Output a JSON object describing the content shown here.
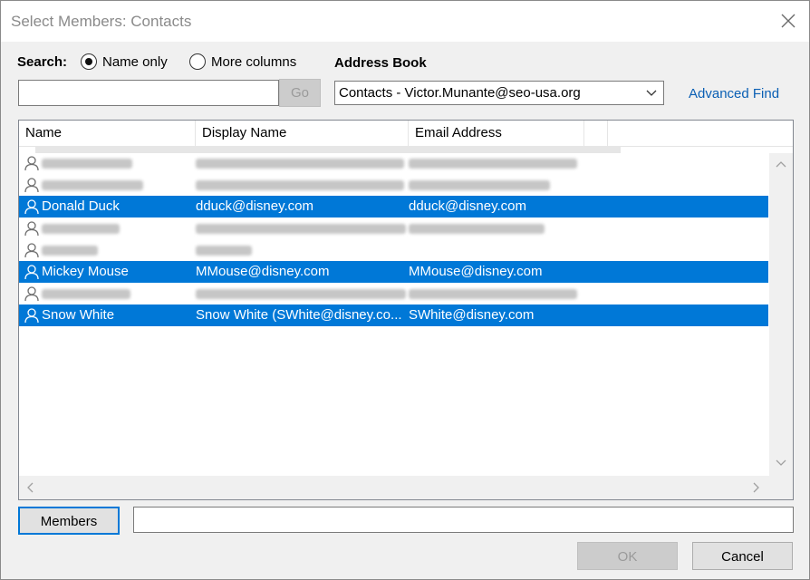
{
  "window": {
    "title": "Select Members: Contacts"
  },
  "search": {
    "label": "Search:",
    "option_name_only": "Name only",
    "option_more_columns": "More columns",
    "selected": "Name only",
    "value": "",
    "go_label": "Go"
  },
  "address_book": {
    "label": "Address Book",
    "selected": "Contacts - Victor.Munante@seo-usa.org",
    "advanced_find": "Advanced Find"
  },
  "table": {
    "columns": [
      "Name",
      "Display Name",
      "Email Address"
    ],
    "rows": [
      {
        "name": "",
        "display": "",
        "email": "",
        "selected": false,
        "blurred": true
      },
      {
        "name": "",
        "display": "",
        "email": "",
        "selected": false,
        "blurred": true
      },
      {
        "name": "Donald Duck",
        "display": "dduck@disney.com",
        "email": "dduck@disney.com",
        "selected": true,
        "blurred": false
      },
      {
        "name": "",
        "display": "",
        "email": "",
        "selected": false,
        "blurred": true
      },
      {
        "name": "",
        "display": "",
        "email": "",
        "selected": false,
        "blurred": true
      },
      {
        "name": "Mickey Mouse",
        "display": "MMouse@disney.com",
        "email": "MMouse@disney.com",
        "selected": true,
        "blurred": false
      },
      {
        "name": "",
        "display": "",
        "email": "",
        "selected": false,
        "blurred": true
      },
      {
        "name": "Snow White",
        "display": "Snow White (SWhite@disney.co...",
        "email": "SWhite@disney.com",
        "selected": true,
        "blurred": false
      }
    ]
  },
  "members": {
    "button_label": "Members",
    "value": ""
  },
  "footer": {
    "ok_label": "OK",
    "cancel_label": "Cancel"
  },
  "colors": {
    "selection": "#0078d7",
    "link": "#0a5fb4"
  }
}
